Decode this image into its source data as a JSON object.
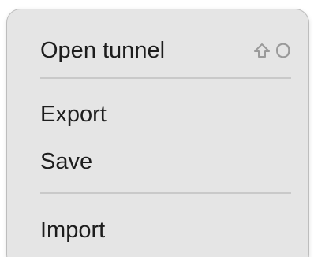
{
  "menu": {
    "items": [
      {
        "label": "Open tunnel",
        "shortcut_icon": "shift-icon",
        "shortcut_key": "O"
      },
      {
        "label": "Export"
      },
      {
        "label": "Save"
      },
      {
        "label": "Import"
      }
    ]
  }
}
